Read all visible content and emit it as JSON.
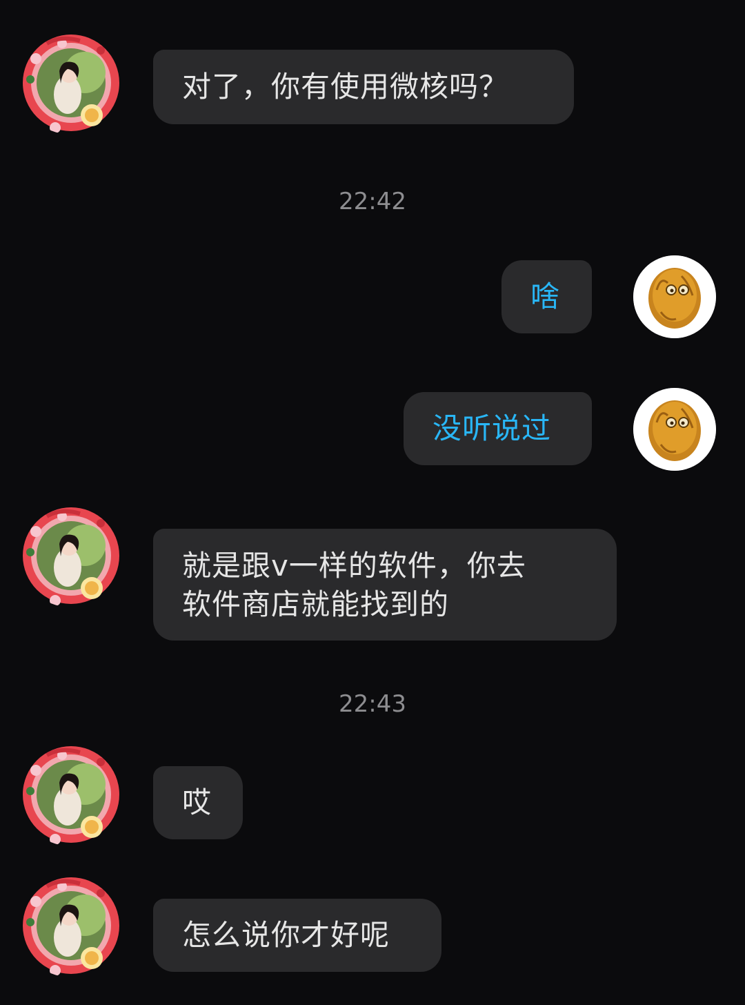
{
  "messages": [
    {
      "from": "other",
      "text": "对了，你有使用微核吗？"
    },
    {
      "from": "self",
      "text": "啥"
    },
    {
      "from": "self",
      "text": "没听说过"
    },
    {
      "from": "other",
      "text": "就是跟v一样的软件，你去软件商店就能找到的",
      "lines": [
        "就是跟v一样的软件，你去",
        "软件商店就能找到的"
      ]
    },
    {
      "from": "other",
      "text": "哎"
    },
    {
      "from": "other",
      "text": "怎么说你才好呢"
    }
  ],
  "timestamps": [
    "22:42",
    "22:43"
  ],
  "colors": {
    "background": "#0b0b0d",
    "bubble": "#2a2a2c",
    "incoming_text": "#e6e6e6",
    "outgoing_text": "#29b6f6",
    "timestamp": "#8d8d90"
  },
  "avatars": {
    "other": "girl-portrait-festive-frame-avatar",
    "self": "wall-nut-avatar"
  }
}
